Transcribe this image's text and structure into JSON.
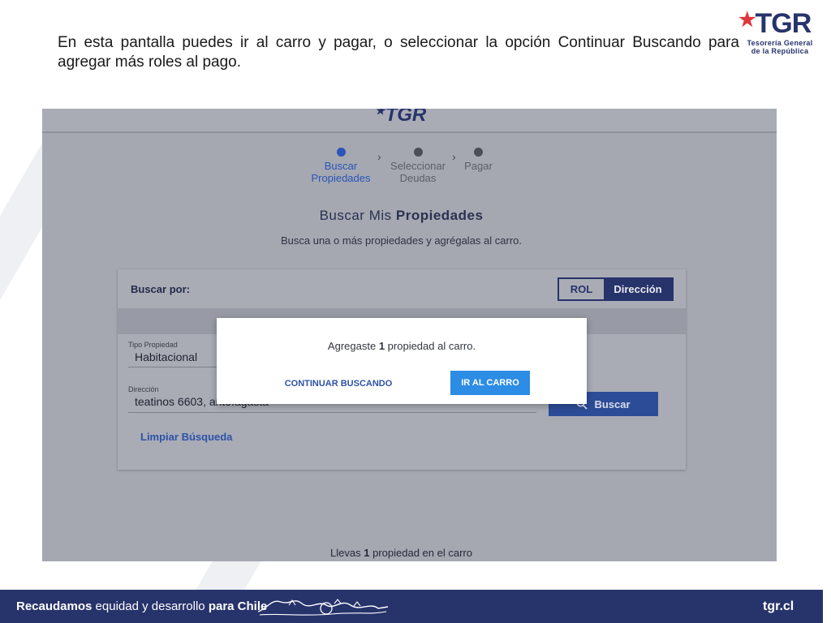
{
  "slide": {
    "intro_text": "En esta pantalla puedes ir al carro y pagar, o seleccionar la opción Continuar Buscando para agregar más roles al pago.",
    "logo_text": "TGR",
    "logo_subtitle_line1": "Tesorería General",
    "logo_subtitle_line2": "de la República"
  },
  "app": {
    "header_logo": "TGR",
    "steps": [
      {
        "line1": "Buscar",
        "line2": "Propiedades",
        "state": "active"
      },
      {
        "line1": "Seleccionar",
        "line2": "Deudas",
        "state": "inactive"
      },
      {
        "line1": "Pagar",
        "line2": "",
        "state": "inactive"
      }
    ],
    "heading_light": "Buscar Mis",
    "heading_bold": "Propiedades",
    "subheading": "Busca una o más propiedades y agrégalas al carro.",
    "search_card": {
      "label": "Buscar por:",
      "toggle_options": [
        "ROL",
        "Dirección"
      ],
      "toggle_selected": "Dirección",
      "property_type_label": "Tipo Propiedad",
      "property_type_value": "Habitacional",
      "address_label": "Dirección",
      "address_value": "teatinos 6603, antofagasta",
      "clear_label": "Limpiar Búsqueda",
      "search_button": "Buscar"
    },
    "cart_status_prefix": "Llevas",
    "cart_status_count": "1",
    "cart_status_suffix": "propiedad en el carro",
    "modal": {
      "msg_prefix": "Agregaste",
      "msg_count": "1",
      "msg_suffix": "propiedad al carro.",
      "continue_button": "CONTINUAR BUSCANDO",
      "cart_button": "IR AL CARRO"
    }
  },
  "footer": {
    "slogan_bold1": "Recaudamos",
    "slogan_middle": "equidad y desarrollo",
    "slogan_bold2": "para Chile",
    "site": "tgr.cl"
  },
  "colors": {
    "brand_navy": "#27336b",
    "brand_red": "#e0363b",
    "accent_blue": "#2d8ce3",
    "overlay_gray": "#a5a8b1"
  }
}
